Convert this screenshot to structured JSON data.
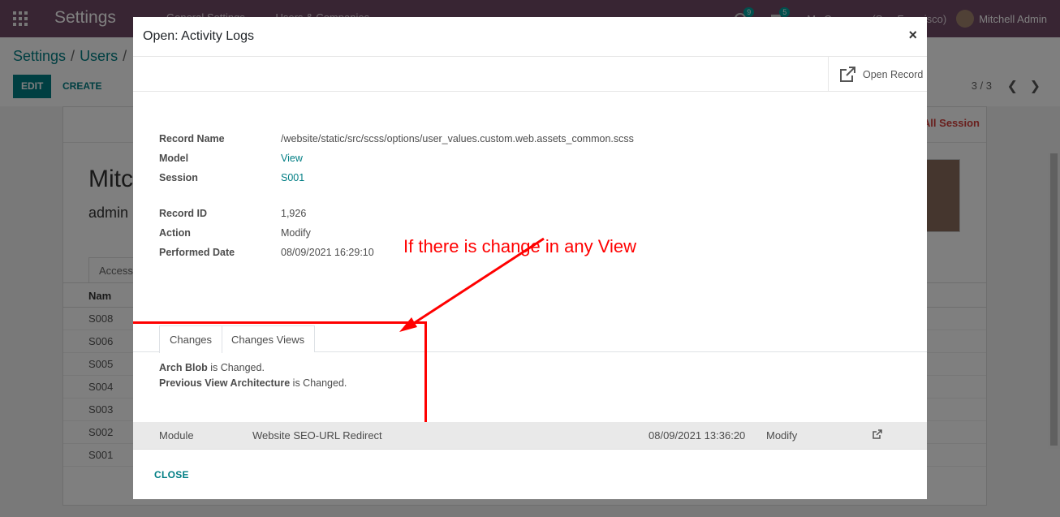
{
  "topbar": {
    "app_title": "Settings",
    "nav": [
      "General Settings",
      "Users & Companies"
    ],
    "activity_count": "9",
    "message_count": "5",
    "company": "My Company (San Francisco)",
    "user": "Mitchell Admin"
  },
  "control_panel": {
    "breadcrumb": [
      "Settings",
      "Users"
    ],
    "edit_label": "EDIT",
    "create_label": "CREATE",
    "pager": "3 / 3"
  },
  "sheet": {
    "kill_label": "All Session",
    "name": "Mitc",
    "login": "admin",
    "tab": "Access",
    "table_header": "Nam",
    "rows": [
      "S008",
      "S006",
      "S005",
      "S004",
      "S003",
      "S002",
      "S001"
    ]
  },
  "modal": {
    "title": "Open: Activity Logs",
    "close_symbol": "×",
    "open_record_label": "Open Record",
    "fields": {
      "record_name_label": "Record Name",
      "record_name_value": "/website/static/src/scss/options/user_values.custom.web.assets_common.scss",
      "model_label": "Model",
      "model_value": "View",
      "session_label": "Session",
      "session_value": "S001",
      "record_id_label": "Record ID",
      "record_id_value": "1,926",
      "action_label": "Action",
      "action_value": "Modify",
      "performed_date_label": "Performed Date",
      "performed_date_value": "08/09/2021 16:29:10"
    },
    "tabs": [
      "Changes",
      "Changes Views"
    ],
    "changes": [
      {
        "field": "Arch Blob",
        "suffix": " is Changed."
      },
      {
        "field": "Previous View Architecture",
        "suffix": " is Changed."
      }
    ],
    "annotation": "If there is change in any View",
    "behind_row": {
      "model": "Module",
      "name": "Website SEO-URL Redirect",
      "date": "08/09/2021 13:36:20",
      "action": "Modify"
    },
    "close_label": "CLOSE"
  },
  "colors": {
    "brand": "#714b67",
    "accent": "#017e84",
    "annotation": "#ff0000"
  },
  "icons": [
    "apps-icon",
    "activity-icon",
    "chat-icon",
    "external-link-icon",
    "close-icon",
    "chevron-left-icon",
    "chevron-right-icon"
  ]
}
